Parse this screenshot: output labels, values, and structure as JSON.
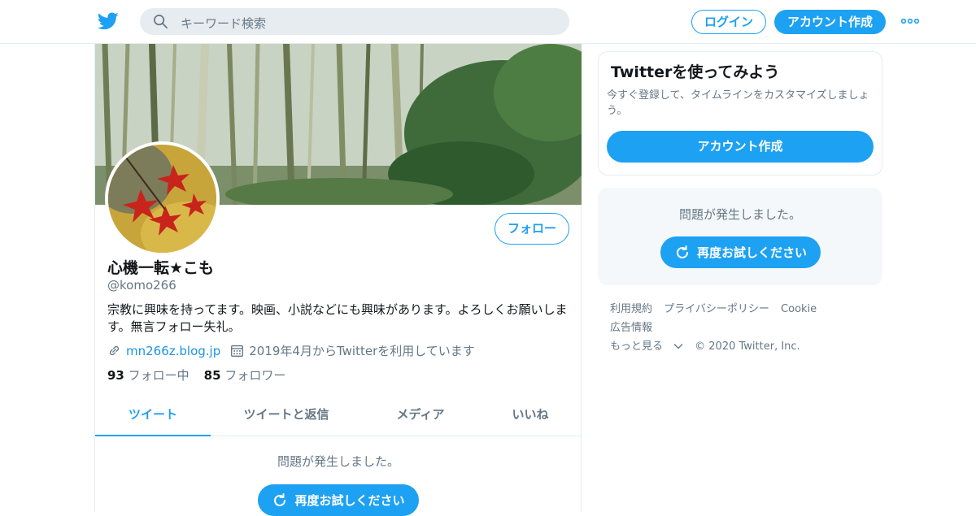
{
  "header": {
    "logo_icon": "twitter-bird-icon",
    "search_placeholder": "キーワード検索",
    "login_label": "ログイン",
    "signup_label": "アカウント作成",
    "more_icon": "more-dots-icon"
  },
  "profile": {
    "display_name": "心機一転★こも",
    "handle": "@komo266",
    "bio": "宗教に興味を持ってます。映画、小説などにも興味があります。よろしくお願いします。無言フォロー失礼。",
    "website": "mn266z.blog.jp",
    "joined": "2019年4月からTwitterを利用しています",
    "following_count": "93",
    "following_label": "フォロー中",
    "followers_count": "85",
    "followers_label": "フォロワー",
    "follow_button": "フォロー"
  },
  "tabs": [
    {
      "label": "ツイート",
      "active": true
    },
    {
      "label": "ツイートと返信",
      "active": false
    },
    {
      "label": "メディア",
      "active": false
    },
    {
      "label": "いいね",
      "active": false
    }
  ],
  "timeline": {
    "error_message": "問題が発生しました。",
    "retry_label": "再度お試しください"
  },
  "sidebar": {
    "signup_title": "Twitterを使ってみよう",
    "signup_desc": "今すぐ登録して、タイムラインをカスタマイズしましょう。",
    "signup_button": "アカウント作成",
    "error_message": "問題が発生しました。",
    "retry_label": "再度お試しください",
    "footer_links": [
      "利用規約",
      "プライバシーポリシー",
      "Cookie",
      "広告情報",
      "もっと見る"
    ],
    "copyright": "© 2020 Twitter, Inc."
  },
  "colors": {
    "accent": "#1da1f2",
    "muted": "#657786",
    "border": "#e6ecf0"
  }
}
